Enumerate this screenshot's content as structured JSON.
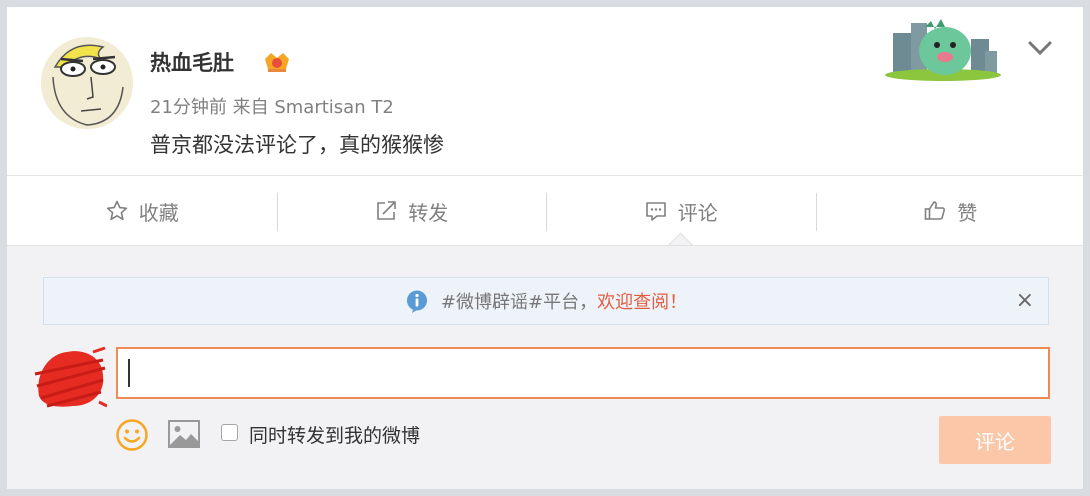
{
  "post": {
    "username": "热血毛肚",
    "meta": "21分钟前 来自 Smartisan T2",
    "text": "普京都没法评论了，真的猴猴惨"
  },
  "actions": [
    {
      "label": "收藏",
      "icon": "star-icon"
    },
    {
      "label": "转发",
      "icon": "share-icon"
    },
    {
      "label": "评论",
      "icon": "comment-icon"
    },
    {
      "label": "赞",
      "icon": "thumbs-up-icon"
    }
  ],
  "notice": {
    "text": "#微博辟谣#平台，",
    "link": "欢迎查阅！",
    "close": "×"
  },
  "composer": {
    "input_value": "",
    "forward_label": "同时转发到我的微博",
    "submit_label": "评论"
  },
  "colors": {
    "accent": "#f08a55",
    "submit_disabled": "#fcc6a9",
    "link": "#e05d41",
    "info_icon": "#5b9bd5"
  }
}
